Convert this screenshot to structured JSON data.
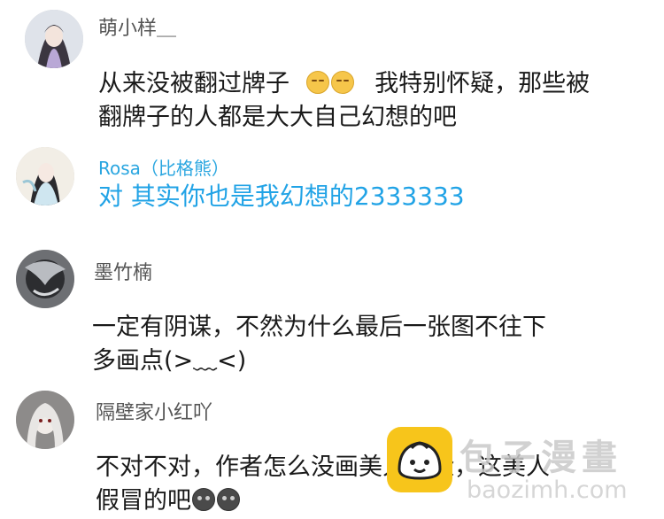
{
  "comments": [
    {
      "username": "萌小样＿",
      "lines": [
        "从来没被翻过牌子",
        "我特别怀疑，那些被",
        "翻牌子的人都是大大自己幻想的吧"
      ],
      "emoji": [
        "pensive-face",
        "pensive-face"
      ]
    },
    {
      "username": "Rosa（比格熊）",
      "lines": [
        "对 其实你也是我幻想的2333333"
      ]
    },
    {
      "username": "墨竹楠",
      "lines": [
        "一定有阴谋，不然为什么最后一张图不往下",
        "多画点(>﹏<)"
      ]
    },
    {
      "username": "隔壁家小红吖",
      "lines": [
        "不对不对，作者怎么没画美人的脸，这美人",
        "假冒的吧"
      ],
      "emoji": [
        "dark-face",
        "dark-face"
      ]
    }
  ],
  "watermark": {
    "title": "包子漫畫",
    "url": "baozimh.com"
  },
  "colors": {
    "reply_blue": "#21a3e6",
    "username_gray": "#555555",
    "watermark_yellow": "#f7c51b"
  }
}
